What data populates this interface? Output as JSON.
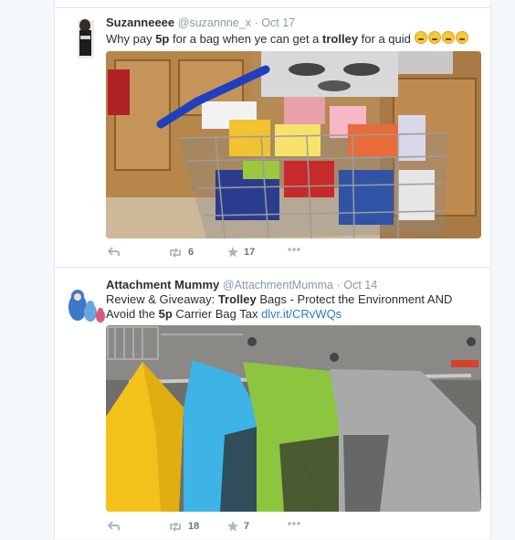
{
  "tweets": [
    {
      "fullname": "Suzanneeee",
      "username": "@suzannne_x",
      "separator": "·",
      "time": "Oct 17",
      "text_parts": {
        "a": "Why pay ",
        "b": "5p",
        "c": " for a bag when ye can get a ",
        "d": "trolley",
        "e": " for a quid "
      },
      "emoji": [
        "crying-face-emoji",
        "crying-face-emoji",
        "crying-face-emoji",
        "crying-face-emoji"
      ],
      "retweets": "6",
      "favorites": "17"
    },
    {
      "fullname": "Attachment Mummy",
      "username": "@AttachmentMumma",
      "separator": "·",
      "time": "Oct 14",
      "text_parts": {
        "a": "Review & Giveaway: ",
        "b": "Trolley",
        "c": " Bags - Protect the Environment AND Avoid the ",
        "d": "5p",
        "e": " Carrier Bag Tax ",
        "link": "dlvr.it/CRvWQs"
      },
      "retweets": "18",
      "favorites": "7"
    }
  ],
  "colors": {
    "link": "#2b7bb9",
    "meta": "#8899a6",
    "background": "#f5f8fa"
  }
}
